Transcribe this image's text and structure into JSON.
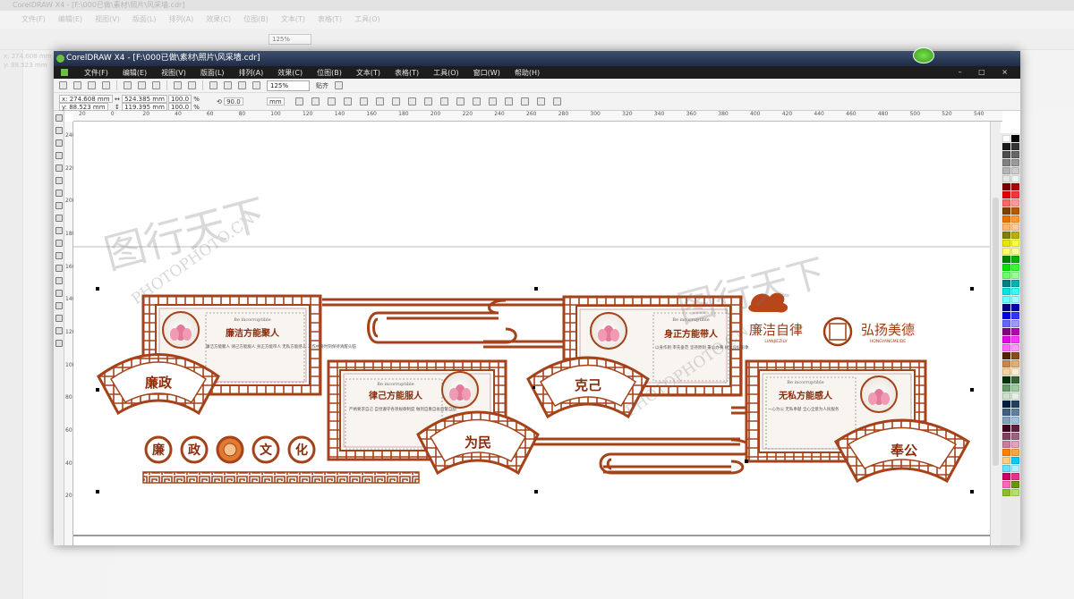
{
  "bg_app": {
    "title": "CorelDRAW X4 - [F:\\000已做\\素材\\照片\\风采墙.cdr]",
    "menu": [
      "文件(F)",
      "编辑(E)",
      "视图(V)",
      "版面(L)",
      "排列(A)",
      "效果(C)",
      "位图(B)",
      "文本(T)",
      "表格(T)",
      "工具(O)"
    ],
    "zoom": "125%",
    "coord_x": "x: 274.608 mm",
    "coord_y": "y: 88.523 mm"
  },
  "window": {
    "title": "CorelDRAW X4 - [F:\\000已做\\素材\\照片\\风采墙.cdr]",
    "menu": [
      "文件(F)",
      "编辑(E)",
      "视图(V)",
      "版面(L)",
      "排列(A)",
      "效果(C)",
      "位图(B)",
      "文本(T)",
      "表格(T)",
      "工具(O)",
      "窗口(W)",
      "帮助(H)"
    ],
    "controls": "– □ ×"
  },
  "toolbar": {
    "zoom": "125%",
    "snap_label": "贴齐",
    "x": "x: 274.608 mm",
    "y": "y: 88.523 mm",
    "width": "524.385 mm",
    "height": "119.395 mm",
    "scale_x": "100.0",
    "scale_y": "100.0",
    "pct": "%",
    "rotation": "90.0",
    "unit": "mm"
  },
  "ruler_h": [
    "20",
    "0",
    "20",
    "40",
    "60",
    "80",
    "100",
    "120",
    "140",
    "160",
    "180",
    "200",
    "220",
    "240",
    "260",
    "280",
    "300",
    "320",
    "340",
    "360",
    "380",
    "400",
    "420",
    "440",
    "460",
    "480",
    "500",
    "520",
    "540"
  ],
  "ruler_v": [
    "240",
    "220",
    "200",
    "180",
    "160",
    "140",
    "120",
    "100",
    "80",
    "60",
    "40",
    "20"
  ],
  "design": {
    "fan_labels": [
      "廉政",
      "为民",
      "克己",
      "奉公"
    ],
    "culture_chars": [
      "廉",
      "政",
      "文",
      "化"
    ],
    "panels": [
      {
        "heading": "廉洁方能聚人",
        "sub": "Be incorruptible",
        "body": "廉洁方能聚人 律己方能服人 身正方能带人 无私方能感人 工作中要时刻保持清醒头脑"
      },
      {
        "heading": "律己方能服人",
        "sub": "Be incorruptible",
        "body": "严格要求自己 自觉遵守各项规章制度 做到自重自省自警自励"
      },
      {
        "heading": "身正方能带人",
        "sub": "Be incorruptible",
        "body": "以身作则 率先垂范 坚持原则 秉公办事 树立良好形象"
      },
      {
        "heading": "无私方能感人",
        "sub": "Be incorruptible",
        "body": "一心为公 无私奉献 全心全意为人民服务"
      }
    ],
    "slogan_1": "廉洁自律",
    "slogan_1_pinyin": "LIANJIEZILV",
    "slogan_2": "弘扬美德",
    "slogan_2_pinyin": "HONGYANGMEIDE"
  },
  "watermark": {
    "brand": "PHOTOPHOTO.CN",
    "script": "图行天下"
  },
  "colors": {
    "brand": "#a23d12",
    "frame": "#a5421a",
    "lotus": "#e47a9a"
  },
  "palette": [
    "#ffffff",
    "#000000",
    "#1a1a1a",
    "#333333",
    "#4d4d4d",
    "#666666",
    "#808080",
    "#999999",
    "#b3b3b3",
    "#cccccc",
    "#e6e6e6",
    "#f2f2f2",
    "#7a0000",
    "#b30000",
    "#e60000",
    "#ff3333",
    "#ff6666",
    "#ff9999",
    "#804000",
    "#b35900",
    "#e67300",
    "#ff9933",
    "#ffb366",
    "#ffcc99",
    "#807f00",
    "#b3b300",
    "#e6e600",
    "#ffff33",
    "#ffff66",
    "#ffff99",
    "#008000",
    "#00b300",
    "#00e600",
    "#33ff33",
    "#66ff66",
    "#99ff99",
    "#008080",
    "#00b3b3",
    "#00e6e6",
    "#33ffff",
    "#66ffff",
    "#99ffff",
    "#000080",
    "#0000b3",
    "#0000e6",
    "#3333ff",
    "#6666ff",
    "#9999ff",
    "#800080",
    "#b300b3",
    "#e600e6",
    "#ff33ff",
    "#ff66ff",
    "#ff99ff",
    "#4d2600",
    "#8c4a1a",
    "#c8864a",
    "#e0b070",
    "#f2d4a0",
    "#fff0d0",
    "#003300",
    "#336633",
    "#669966",
    "#99cc99",
    "#cce0cc",
    "#e6f0e6",
    "#002040",
    "#204060",
    "#406080",
    "#6080a0",
    "#80a0c0",
    "#a0c0e0",
    "#400020",
    "#602040",
    "#804060",
    "#a06080",
    "#c080a0",
    "#e0a0c0",
    "#ff8000",
    "#ffa640",
    "#ffcc80",
    "#00ccff",
    "#66e0ff",
    "#b3f0ff",
    "#cc0066",
    "#e6338c",
    "#ff66b3",
    "#669900",
    "#8cbf26",
    "#b3e066"
  ]
}
